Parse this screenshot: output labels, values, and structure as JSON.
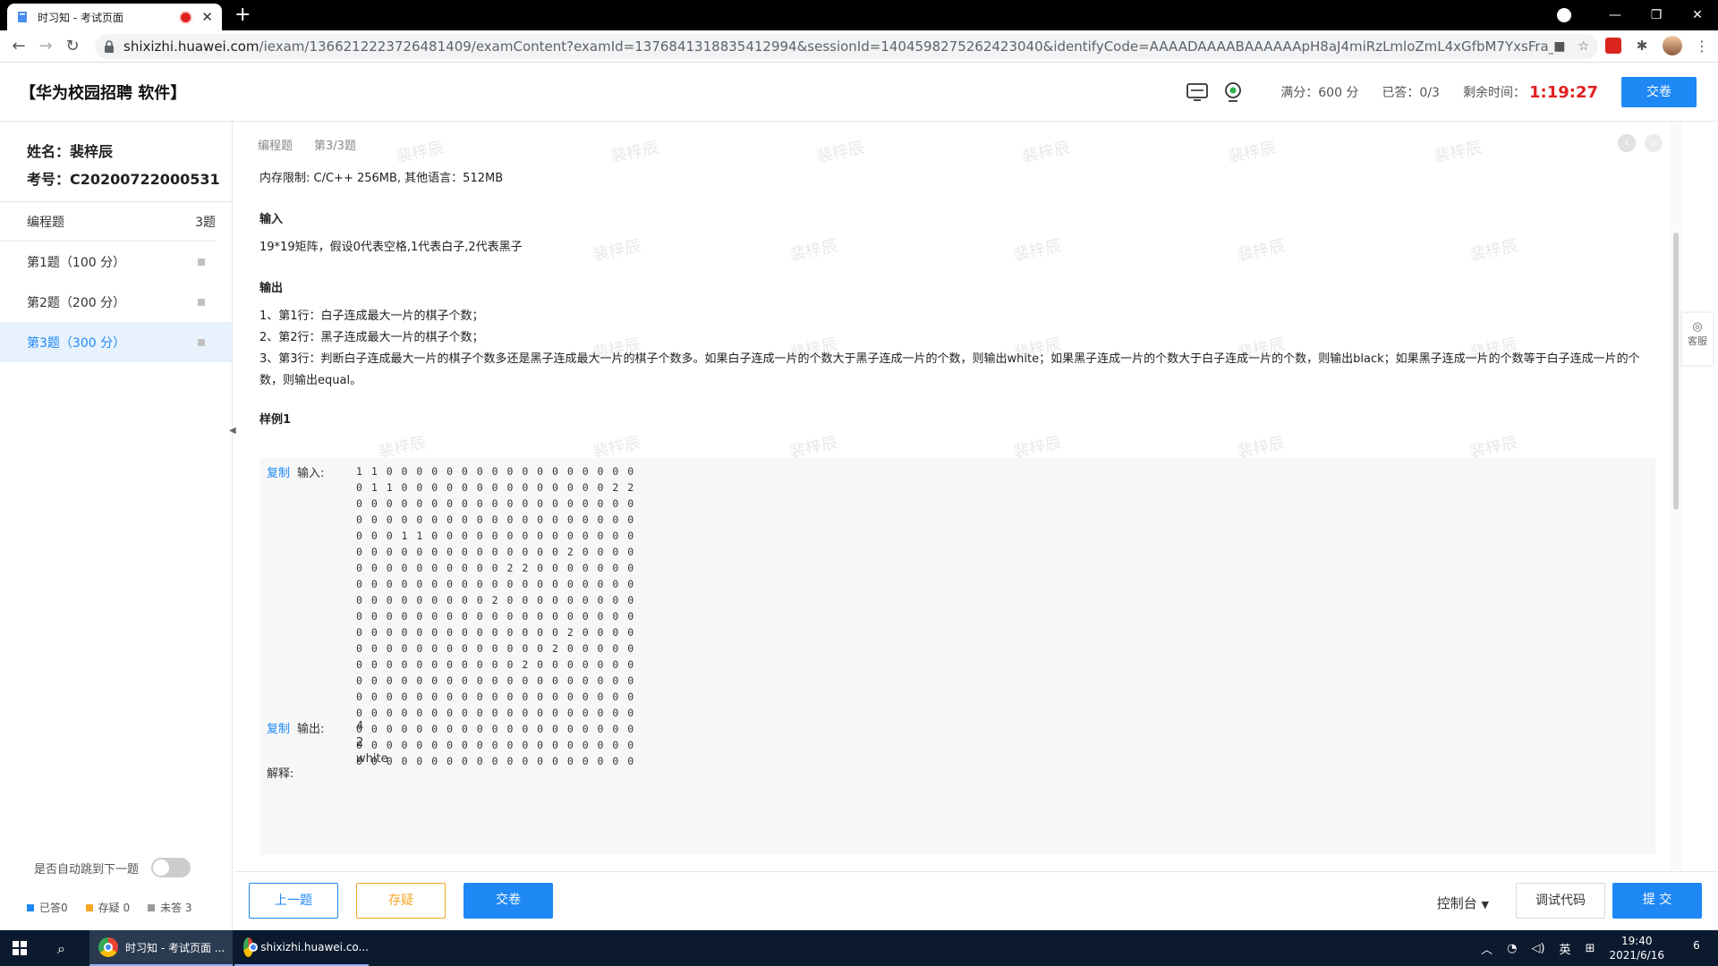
{
  "browser": {
    "tab_title": "时习知 - 考试页面",
    "url_host": "shixizhi.huawei.com",
    "url_path": "/iexam/1366212223726481409/examContent?examId=1376841318835412994&sessionId=1404598275262423040&identifyCode=AAAADAAAABAAAAAApH8aJ4miRzLmloZmL4xGfbM7YxsFra_lhTz5M_Dku058YFPl..."
  },
  "header": {
    "exam_title": "【华为校园招聘 软件】",
    "full_score": "满分：600 分",
    "answered": "已答：0/3",
    "remaining_label": "剩余时间：",
    "timer": "1:19:27",
    "submit_label": "交卷"
  },
  "student": {
    "name": "姓名：裴梓辰",
    "id": "考号：C20200722000531"
  },
  "sidebar": {
    "group_label": "编程题",
    "group_count": "3题",
    "questions": [
      {
        "label": "第1题（100 分）"
      },
      {
        "label": "第2题（200 分）"
      },
      {
        "label": "第3题（300 分）"
      }
    ],
    "auto_jump_label": "是否自动跳到下一题",
    "legend": {
      "answered": "已答0",
      "doubt": "存疑 0",
      "unanswered": "未答 3"
    }
  },
  "main": {
    "crumb_type": "编程题",
    "crumb_index": "第3/3题",
    "watermark": "裴梓辰",
    "memory_limit": "内存限制: C/C++ 256MB, 其他语言：512MB",
    "input_heading": "输入",
    "input_desc": "19*19矩阵，假设0代表空格,1代表白子,2代表黑子",
    "output_heading": "输出",
    "output_lines": [
      "1、第1行：白子连成最大一片的棋子个数；",
      "2、第2行：黑子连成最大一片的棋子个数；",
      "3、第3行：判断白子连成最大一片的棋子个数多还是黑子连成最大一片的棋子个数多。如果白子连成一片的个数大于黑子连成一片的个数，则输出white；如果黑子连成一片的个数大于白子连成一片的个数，则输出black；如果黑子连成一片的个数等于白子连成一片的个数，则输出equal。"
    ],
    "sample_heading": "样例1",
    "copy_label": "复制",
    "input_label": "输入:",
    "output_label": "输出:",
    "explain_label": "解释:",
    "sample_input": [
      "1 1 0 0 0 0 0 0 0 0 0 0 0 0 0 0 0 0 0",
      "0 1 1 0 0 0 0 0 0 0 0 0 0 0 0 0 0 2 2",
      "0 0 0 0 0 0 0 0 0 0 0 0 0 0 0 0 0 0 0",
      "0 0 0 0 0 0 0 0 0 0 0 0 0 0 0 0 0 0 0",
      "0 0 0 1 1 0 0 0 0 0 0 0 0 0 0 0 0 0 0",
      "0 0 0 0 0 0 0 0 0 0 0 0 0 0 2 0 0 0 0",
      "0 0 0 0 0 0 0 0 0 0 2 2 0 0 0 0 0 0 0",
      "0 0 0 0 0 0 0 0 0 0 0 0 0 0 0 0 0 0 0",
      "0 0 0 0 0 0 0 0 0 2 0 0 0 0 0 0 0 0 0",
      "0 0 0 0 0 0 0 0 0 0 0 0 0 0 0 0 0 0 0",
      "0 0 0 0 0 0 0 0 0 0 0 0 0 0 2 0 0 0 0",
      "0 0 0 0 0 0 0 0 0 0 0 0 0 2 0 0 0 0 0",
      "0 0 0 0 0 0 0 0 0 0 0 2 0 0 0 0 0 0 0",
      "0 0 0 0 0 0 0 0 0 0 0 0 0 0 0 0 0 0 0",
      "0 0 0 0 0 0 0 0 0 0 0 0 0 0 0 0 0 0 0",
      "0 0 0 0 0 0 0 0 0 0 0 0 0 0 0 0 0 0 0",
      "0 0 0 0 0 0 0 0 0 0 0 0 0 0 0 0 0 0 0",
      "0 0 0 0 0 0 0 0 0 0 0 0 0 0 0 0 0 0 0",
      "0 0 0 0 0 0 0 0 0 0 0 0 0 0 0 0 0 0 0"
    ],
    "sample_output": [
      "4",
      "2",
      "white"
    ],
    "customer_service": "客服"
  },
  "bottom": {
    "prev_label": "上一题",
    "save_label": "存疑",
    "hand_in_label": "交卷",
    "console_label": "控制台",
    "debug_label": "调试代码",
    "submit_label": "提 交"
  },
  "taskbar": {
    "app1": "时习知 - 考试页面 ...",
    "app2": "shixizhi.huawei.co...",
    "ime": "英",
    "time": "19:40",
    "date": "2021/6/16",
    "notif_count": "6"
  },
  "colors": {
    "accent": "#1e88f5",
    "timer": "#e02020",
    "doubt": "#f5a623"
  }
}
